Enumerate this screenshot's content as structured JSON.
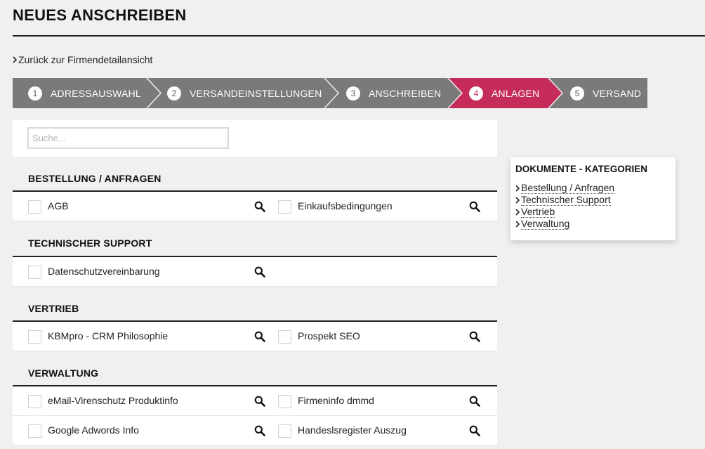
{
  "page": {
    "title": "NEUES ANSCHREIBEN"
  },
  "back_link": {
    "label": "Zurück zur Firmendetailansicht"
  },
  "stepper": {
    "colors": {
      "inactive": "#7a7a7a",
      "active": "#c52c5a"
    },
    "steps": [
      {
        "number": "1",
        "label": "ADRESSAUSWAHL",
        "active": false
      },
      {
        "number": "2",
        "label": "VERSANDEINSTELLUNGEN",
        "active": false
      },
      {
        "number": "3",
        "label": "ANSCHREIBEN",
        "active": false
      },
      {
        "number": "4",
        "label": "ANLAGEN",
        "active": true
      },
      {
        "number": "5",
        "label": "VERSAND",
        "active": false
      }
    ]
  },
  "search": {
    "placeholder": "Suche..."
  },
  "categories": [
    {
      "title": "BESTELLUNG / ANFRAGEN",
      "rows": [
        [
          "AGB",
          "Einkaufsbedingungen"
        ]
      ]
    },
    {
      "title": "TECHNISCHER SUPPORT",
      "rows": [
        [
          "Datenschutzvereinbarung"
        ]
      ]
    },
    {
      "title": "VERTRIEB",
      "rows": [
        [
          "KBMpro - CRM Philosophie",
          "Prospekt SEO"
        ]
      ]
    },
    {
      "title": "VERWALTUNG",
      "rows": [
        [
          "eMail-Virenschutz Produktinfo",
          "Firmeninfo dmmd"
        ],
        [
          "Google Adwords Info",
          "Handeslsregister Auszug"
        ]
      ]
    }
  ],
  "sidebar": {
    "title": "DOKUMENTE - KATEGORIEN",
    "items": [
      "Bestellung / Anfragen",
      "Technischer Support",
      "Vertrieb",
      "Verwaltung"
    ]
  },
  "icons": {
    "back": "chevron-right-icon",
    "doc_search": "magnifier-icon",
    "sidebar_item": "chevron-right-icon"
  }
}
